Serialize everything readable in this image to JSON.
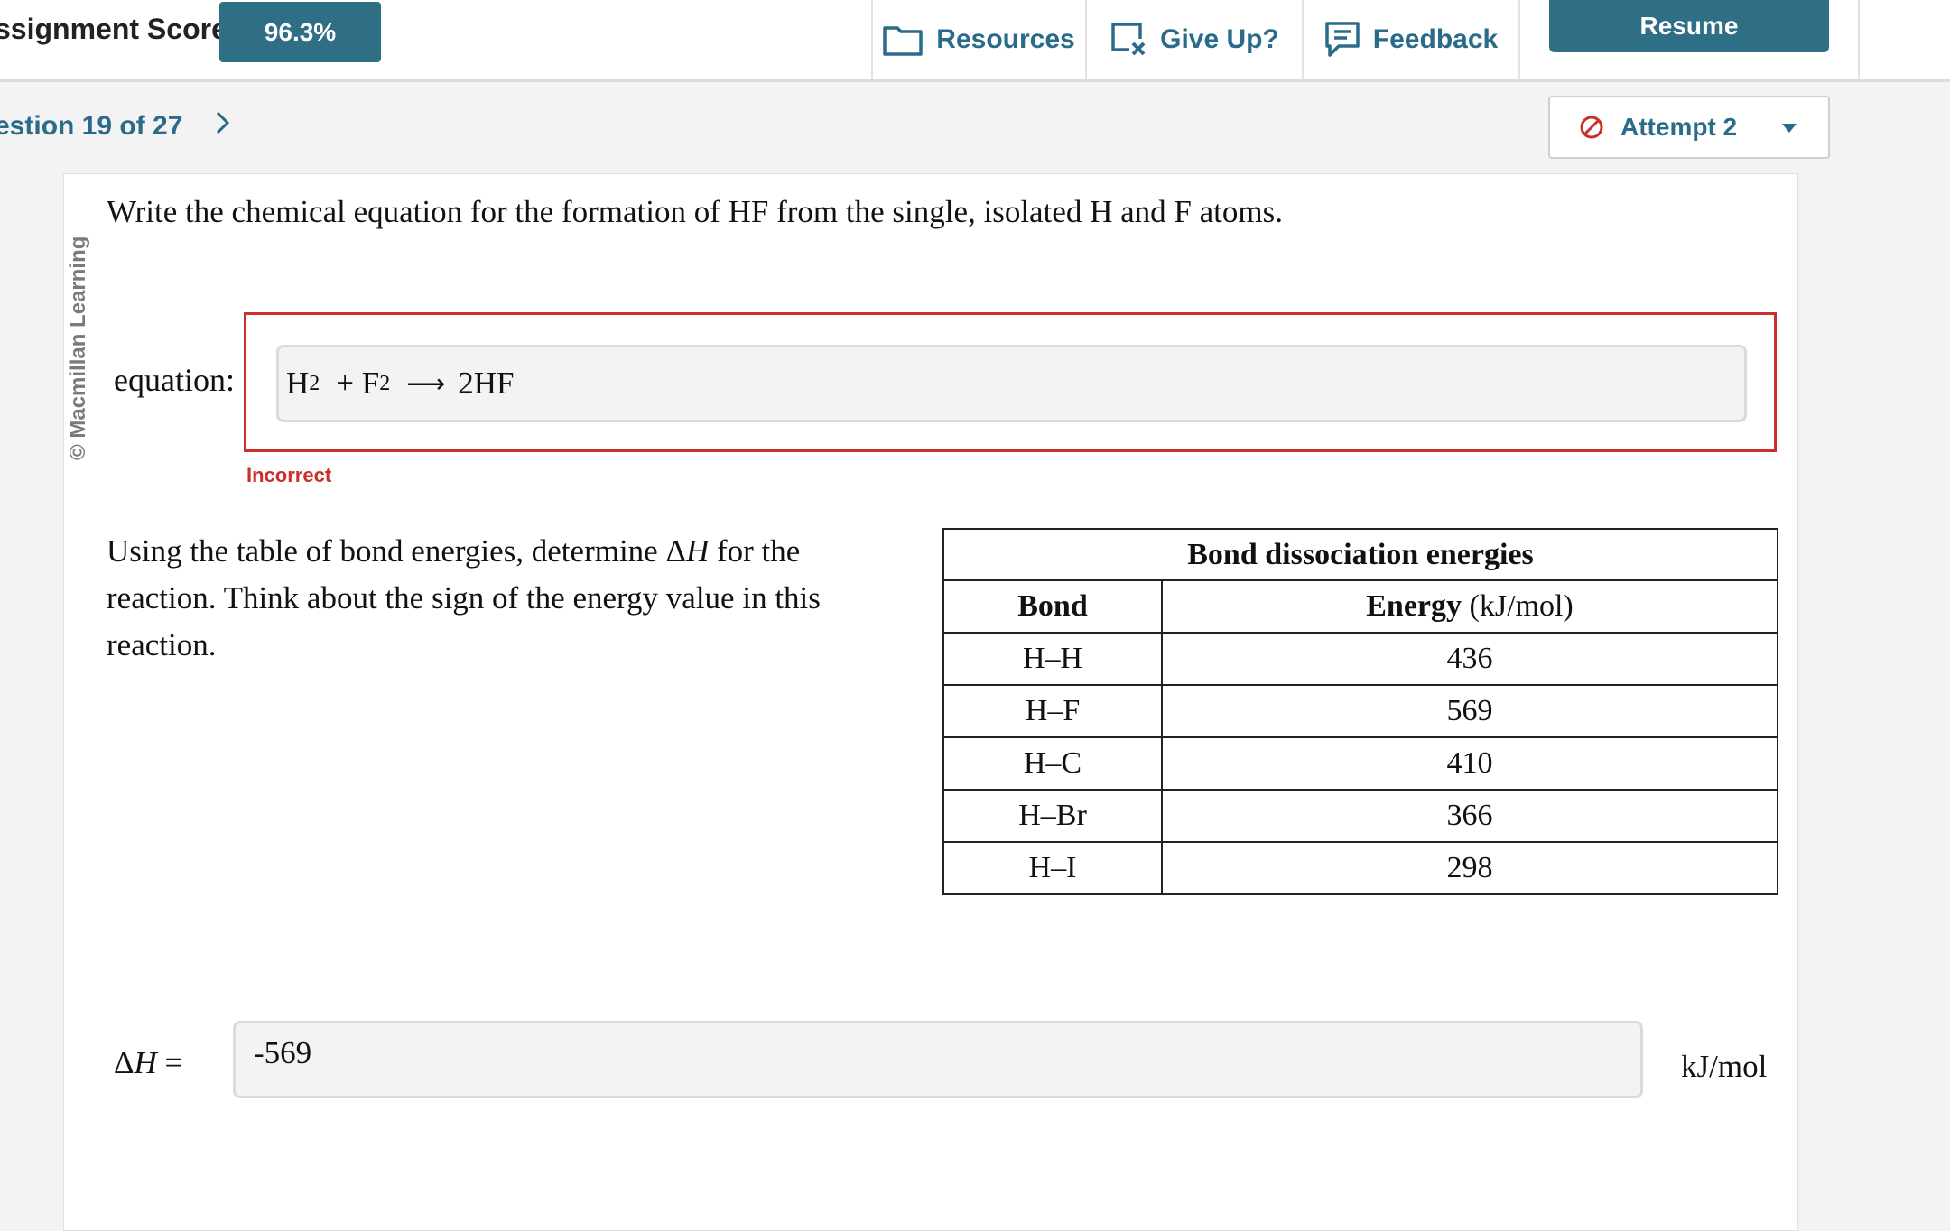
{
  "header": {
    "score_label": "ssignment Score:",
    "score_value": "96.3%",
    "resources_label": "Resources",
    "give_up_label": "Give Up?",
    "feedback_label": "Feedback",
    "resume_label": "Resume"
  },
  "question_nav": {
    "label": "estion 19 of 27",
    "attempt_label": "Attempt 2"
  },
  "watermark": "© Macmillan Learning",
  "part1": {
    "prompt": "Write the chemical equation for the formation of HF from the single, isolated H and F atoms.",
    "field_label": "equation:",
    "answer": {
      "term1": "H",
      "term1_sub": "2",
      "plus": "+ F",
      "term2_sub": "2",
      "arrow": "⟶",
      "product": "2HF"
    },
    "status": "Incorrect"
  },
  "part2": {
    "prompt_before": "Using the table of bond energies, determine Δ",
    "prompt_var": "H",
    "prompt_after": " for the reaction. Think about the sign of the energy value in this reaction.",
    "delta_label": "Δ",
    "delta_var": "H",
    "delta_eq": " =",
    "answer": "-569",
    "unit": "kJ/mol"
  },
  "table": {
    "caption": "Bond dissociation energies",
    "col_bond": "Bond",
    "col_energy": "Energy",
    "col_energy_unit": " (kJ/mol)",
    "rows": [
      {
        "bond": "H–H",
        "energy": "436"
      },
      {
        "bond": "H–F",
        "energy": "569"
      },
      {
        "bond": "H–C",
        "energy": "410"
      },
      {
        "bond": "H–Br",
        "energy": "366"
      },
      {
        "bond": "H–I",
        "energy": "298"
      }
    ]
  },
  "colors": {
    "accent": "#2f6f86",
    "error": "#c9302c"
  },
  "icons": [
    "folder-icon",
    "give-up-icon",
    "feedback-icon",
    "chevron-right-icon",
    "no-entry-icon",
    "caret-down-icon"
  ]
}
